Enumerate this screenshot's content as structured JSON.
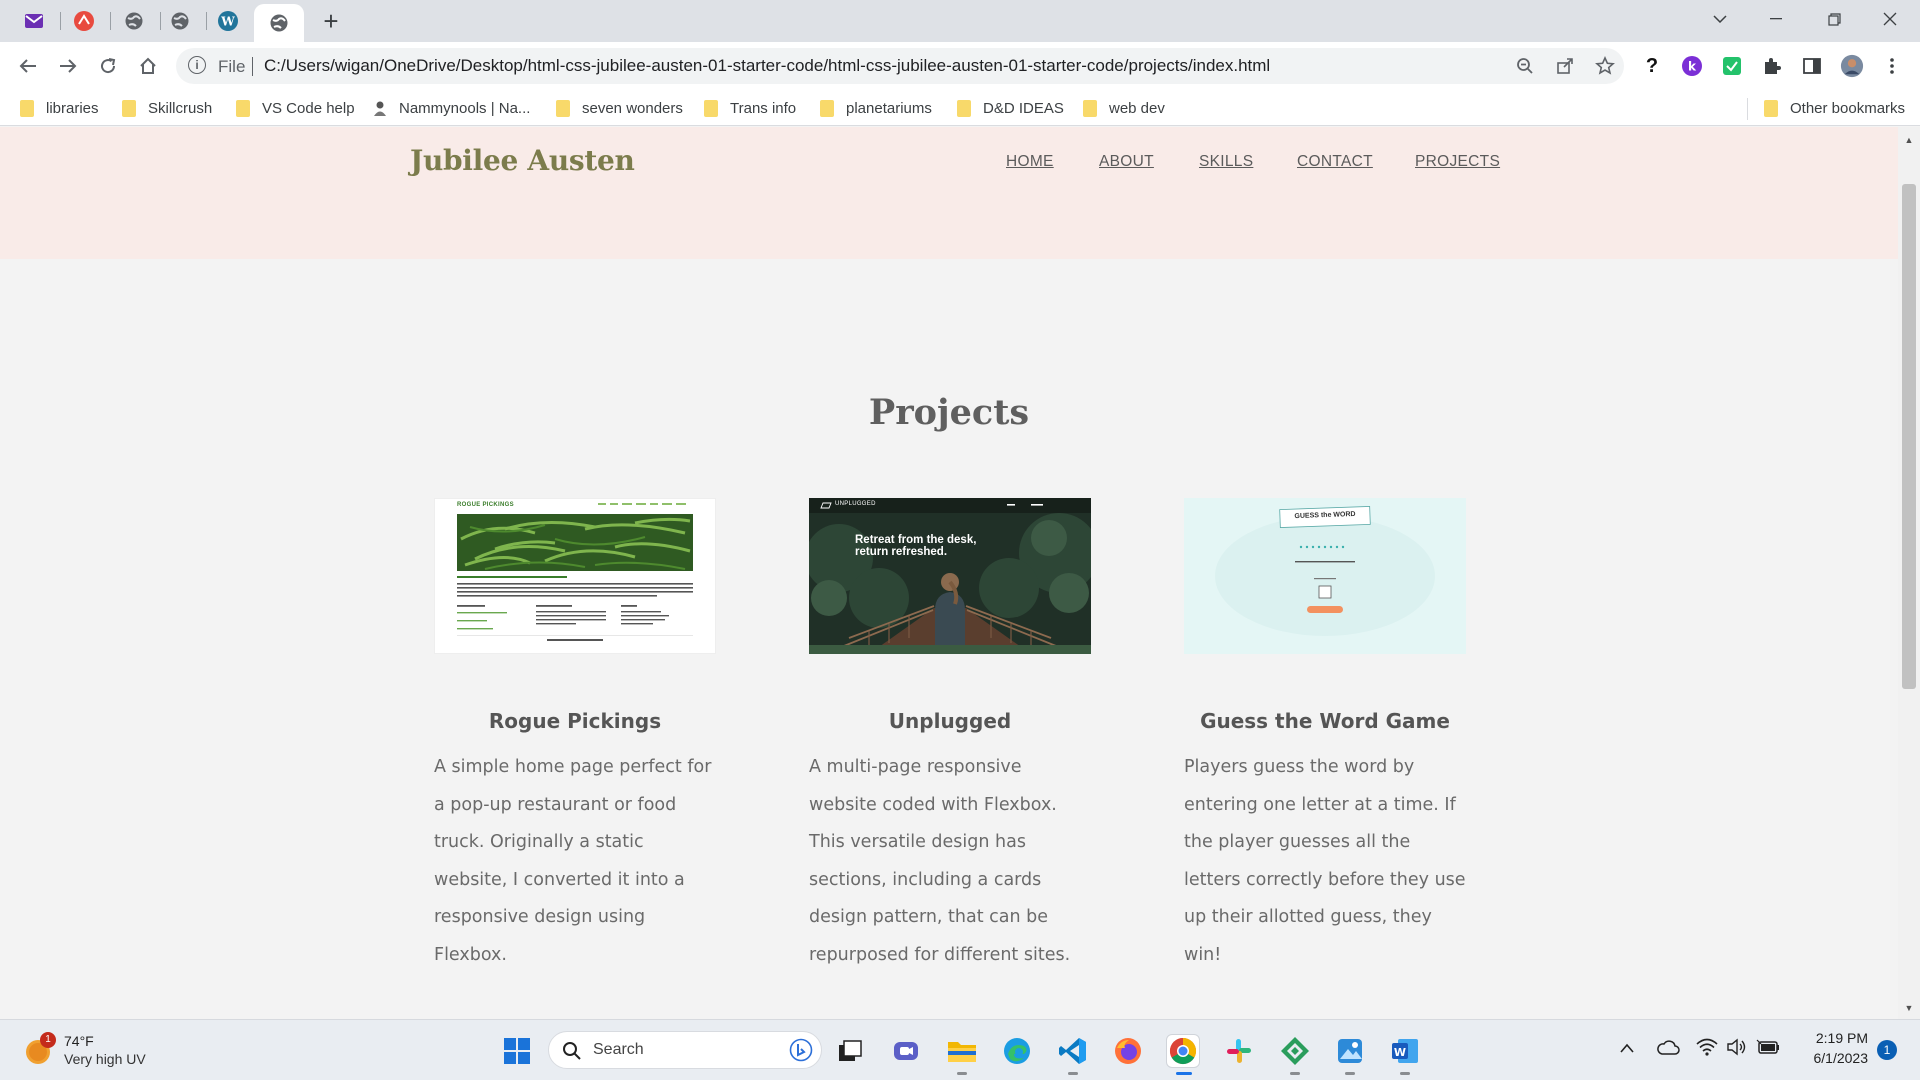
{
  "browser": {
    "address": {
      "scheme_label": "File",
      "url": "C:/Users/wigan/OneDrive/Desktop/html-css-jubilee-austen-01-starter-code/html-css-jubilee-austen-01-starter-code/projects/index.html"
    },
    "bookmarks": [
      {
        "label": "libraries",
        "icon": "folder-icon"
      },
      {
        "label": "Skillcrush",
        "icon": "folder-icon"
      },
      {
        "label": "VS Code help",
        "icon": "folder-icon"
      },
      {
        "label": "Nammynools | Na...",
        "icon": "site-icon"
      },
      {
        "label": "seven wonders",
        "icon": "folder-icon"
      },
      {
        "label": "Trans info",
        "icon": "folder-icon"
      },
      {
        "label": "planetariums",
        "icon": "folder-icon"
      },
      {
        "label": "D&D IDEAS",
        "icon": "folder-icon"
      },
      {
        "label": "web dev",
        "icon": "folder-icon"
      }
    ],
    "other_bookmarks": "Other bookmarks"
  },
  "site": {
    "logo": "Jubilee Austen",
    "nav": [
      "HOME",
      "ABOUT",
      "SKILLS",
      "CONTACT",
      "PROJECTS"
    ],
    "page_title": "Projects",
    "projects": [
      {
        "title": "Rogue Pickings",
        "description": "A simple home page perfect for a pop-up restaurant or food truck. Originally a static website, I converted it into a responsive design using Flexbox.",
        "thumb_brand": "ROGUE PICKINGS"
      },
      {
        "title": "Unplugged",
        "description": "A multi-page responsive website coded with Flexbox. This versatile design has sections, including a cards design pattern, that can be repurposed for different sites.",
        "thumb_brand": "UNPLUGGED",
        "thumb_headline": "Retreat from the desk, return refreshed."
      },
      {
        "title": "Guess the Word Game",
        "description": "Players guess the word by entering one letter at a time. If the player guesses all the letters correctly before they use up their allotted guess, they win!",
        "thumb_brand": "GUESS the WORD"
      }
    ]
  },
  "taskbar": {
    "weather": {
      "temp": "74°F",
      "condition": "Very high UV",
      "badge": "1"
    },
    "search_placeholder": "Search",
    "clock": {
      "time": "2:19 PM",
      "date": "6/1/2023"
    },
    "notification_count": "1"
  },
  "colors": {
    "header_bg": "#f9ebe8",
    "logo": "#7c7c4c",
    "page_bg": "#f3f3f3"
  }
}
